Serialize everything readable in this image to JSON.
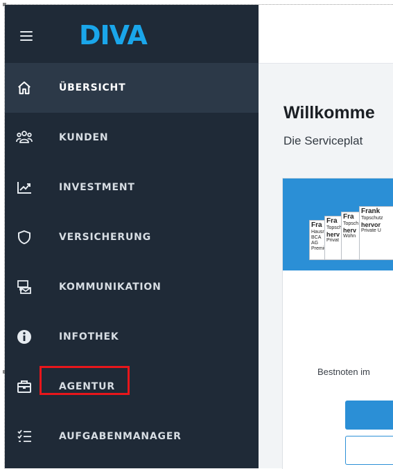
{
  "app": {
    "logo_text": "DIVA",
    "brand_colors": {
      "blue": "#1aa6ea",
      "red": "#e23b3b",
      "sidebar": "#1f2a37"
    }
  },
  "sidebar": {
    "items": [
      {
        "label": "ÜBERSICHT",
        "icon": "home-icon",
        "active": true
      },
      {
        "label": "KUNDEN",
        "icon": "users-icon",
        "active": false
      },
      {
        "label": "INVESTMENT",
        "icon": "chart-trend-icon",
        "active": false
      },
      {
        "label": "VERSICHERUNG",
        "icon": "shield-icon",
        "active": false
      },
      {
        "label": "KOMMUNIKATION",
        "icon": "communication-icon",
        "active": false
      },
      {
        "label": "INFOTHEK",
        "icon": "info-icon",
        "active": false
      },
      {
        "label": "AGENTUR",
        "icon": "briefcase-icon",
        "active": false,
        "highlighted": true
      },
      {
        "label": "AUFGABENMANAGER",
        "icon": "task-list-icon",
        "active": false
      }
    ]
  },
  "main": {
    "welcome": "Willkomme",
    "subtitle": "Die Serviceplat",
    "card": {
      "bestnoten": "Bestnoten im",
      "badges": [
        {
          "title": "Fra",
          "line1": "Hausr",
          "line2": "BCA AG",
          "line3": "Premiu"
        },
        {
          "title": "Fra",
          "line1": "Topsch",
          "line2": "herv",
          "line3": "Privat"
        },
        {
          "title": "Fra",
          "line1": "Topsch",
          "line2": "herv",
          "line3": "Wohn"
        },
        {
          "title": "Frank",
          "line1": "Topschutz",
          "line2": "hervor",
          "line3": "Private U"
        }
      ]
    }
  }
}
